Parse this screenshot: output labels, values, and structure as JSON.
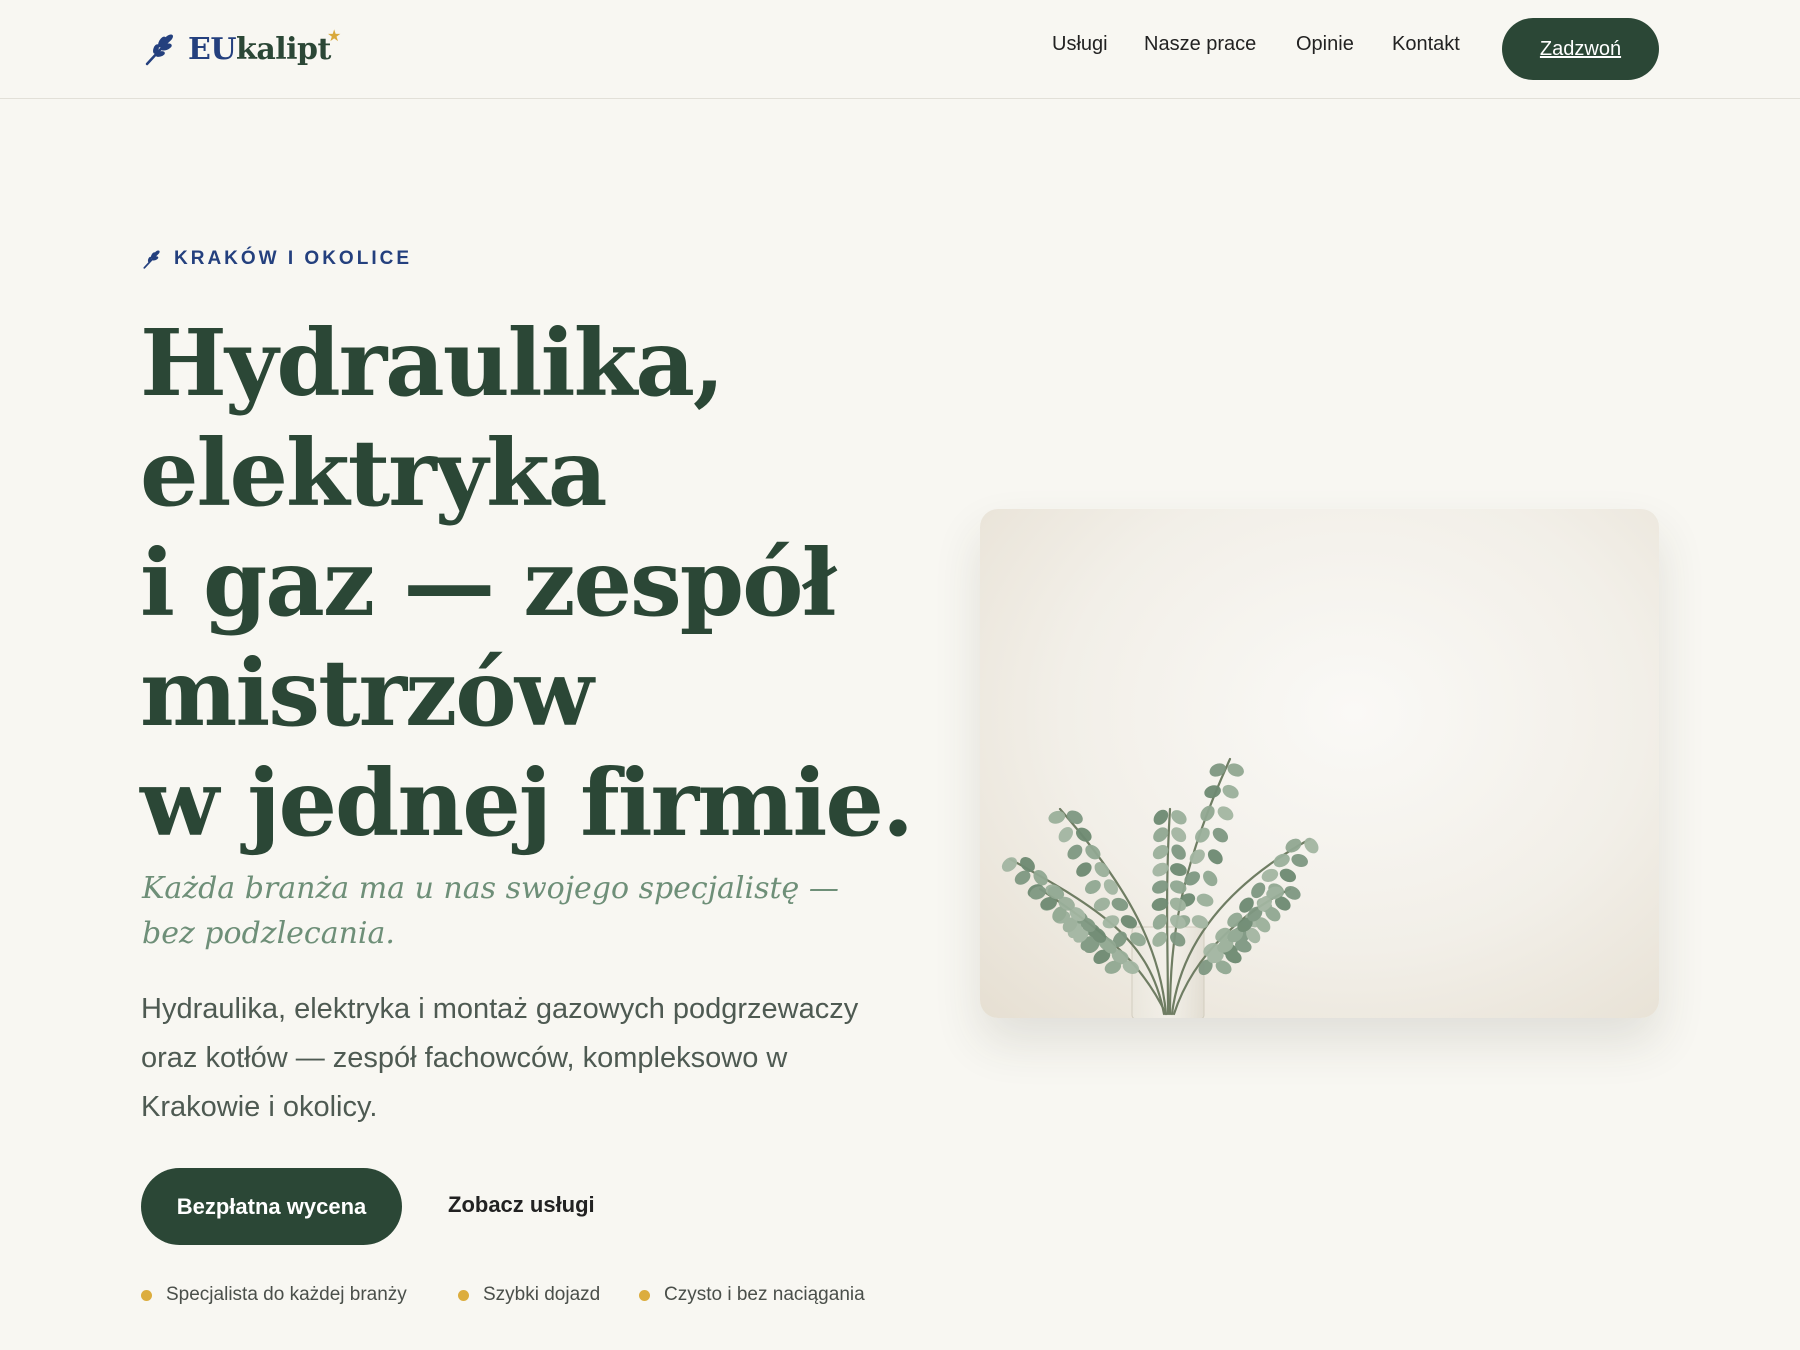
{
  "brand": {
    "name_part1": "EU",
    "name_part2": "kalipt",
    "accent_blue": "#24407e",
    "accent_green": "#2b4736",
    "accent_gold": "#dcad3e"
  },
  "nav": {
    "items": [
      {
        "label": "Usługi"
      },
      {
        "label": "Nasze prace"
      },
      {
        "label": "Opinie"
      },
      {
        "label": "Kontakt"
      }
    ],
    "call_label": "Zadzwoń"
  },
  "hero": {
    "eyebrow": "KRAKÓW I OKOLICE",
    "headline_lines": [
      "Hydraulika,",
      "elektryka",
      "i gaz — zespół",
      "mistrzów",
      "w jednej firmie."
    ],
    "subhead": "Każda branża ma u nas swojego specjalistę — bez podzlecania.",
    "lede": "Hydraulika, elektryka i montaż gazowych podgrzewaczy oraz kotłów — zespół fachowców, kompleksowo w Krakowie i okolicy.",
    "cta_primary": "Bezpłatna wycena",
    "cta_secondary": "Zobacz usługi",
    "features": [
      {
        "label": "Specjalista do każdej branży"
      },
      {
        "label": "Szybki dojazd"
      },
      {
        "label": "Czysto i bez naciągania"
      }
    ],
    "image_icon": "eucalyptus-vase-photo"
  }
}
